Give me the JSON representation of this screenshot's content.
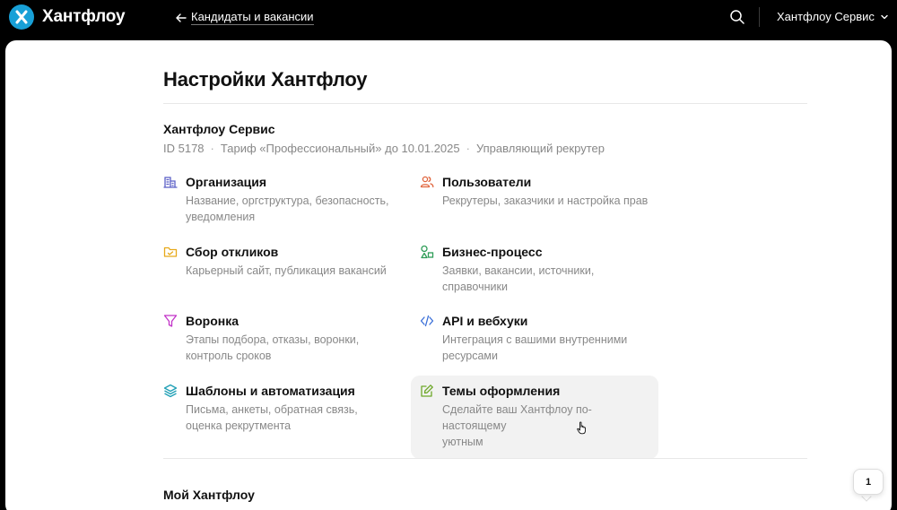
{
  "header": {
    "logo_text": "Хантфлоу",
    "back_label": "Кандидаты и вакансии",
    "account_label": "Хантфлоу Сервис"
  },
  "page": {
    "title": "Настройки Хантфлоу"
  },
  "company": {
    "name": "Хантфлоу Сервис",
    "id": "ID 5178",
    "tariff": "Тариф «Профессиональный» до 10.01.2025",
    "role": "Управляющий рекрутер",
    "separator": "·"
  },
  "settings": [
    {
      "title": "Организация",
      "desc_line1": "Название, оргструктура, безопасность,",
      "desc_line2": "уведомления",
      "icon": "building-icon",
      "color": "#5b5fc7"
    },
    {
      "title": "Пользователи",
      "desc_line1": "Рекрутеры, заказчики и настройка прав",
      "desc_line2": "",
      "icon": "users-icon",
      "color": "#e0643c"
    },
    {
      "title": "Сбор откликов",
      "desc_line1": "Карьерный сайт, публикация вакансий",
      "desc_line2": "",
      "icon": "folder-icon",
      "color": "#e7a91a"
    },
    {
      "title": "Бизнес-процесс",
      "desc_line1": "Заявки, вакансии, источники,",
      "desc_line2": "справочники",
      "icon": "process-icon",
      "color": "#2e9d57"
    },
    {
      "title": "Воронка",
      "desc_line1": "Этапы подбора, отказы, воронки,",
      "desc_line2": "контроль сроков",
      "icon": "funnel-icon",
      "color": "#c233c8"
    },
    {
      "title": "API и вебхуки",
      "desc_line1": "Интеграция с вашими внутренними",
      "desc_line2": "ресурсами",
      "icon": "code-icon",
      "color": "#3a6fd8"
    },
    {
      "title": "Шаблоны и автоматизация",
      "desc_line1": "Письма, анкеты, обратная связь,",
      "desc_line2": "оценка рекрутмента",
      "icon": "layers-icon",
      "color": "#1f9fb5"
    },
    {
      "title": "Темы оформления",
      "desc_line1": "Сделайте ваш Хантфлоу по-настоящему",
      "desc_line2": "уютным",
      "icon": "edit-icon",
      "color": "#6ea82a"
    }
  ],
  "my_section": {
    "title": "Мой Хантфлоу"
  },
  "chat": {
    "badge": "1"
  }
}
